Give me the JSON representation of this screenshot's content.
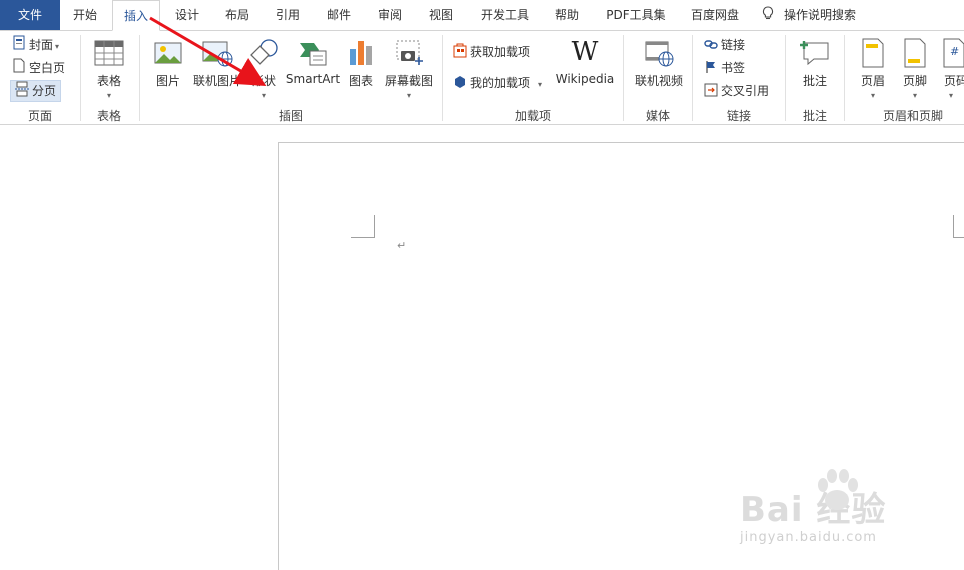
{
  "tabs": [
    "文件",
    "开始",
    "插入",
    "设计",
    "布局",
    "引用",
    "邮件",
    "审阅",
    "视图",
    "开发工具",
    "帮助",
    "PDF工具集",
    "百度网盘"
  ],
  "tell_me": "操作说明搜索",
  "ribbon": {
    "pages": {
      "cover": "封面",
      "blank": "空白页",
      "break": "分页",
      "label": "页面"
    },
    "tables": {
      "table": "表格",
      "label": "表格"
    },
    "illustrations": {
      "picture": "图片",
      "online_picture": "联机图片",
      "shapes": "形状",
      "smartart": "SmartArt",
      "chart": "图表",
      "screenshot": "屏幕截图",
      "label": "插图"
    },
    "addins": {
      "get": "获取加载项",
      "my": "我的加载项",
      "wikipedia": "Wikipedia",
      "label": "加载项"
    },
    "media": {
      "online_video": "联机视频",
      "label": "媒体"
    },
    "links": {
      "link": "链接",
      "bookmark": "书签",
      "cross_ref": "交叉引用",
      "label": "链接"
    },
    "comments": {
      "comment": "批注",
      "label": "批注"
    },
    "header_footer": {
      "header": "页眉",
      "footer": "页脚",
      "page_number": "页码",
      "label": "页眉和页脚"
    }
  },
  "document": {
    "paragraph_mark": "↵"
  },
  "watermark": {
    "brand": "Bai  经验",
    "url": "jingyan.baidu.com"
  },
  "colors": {
    "accent": "#2b579a",
    "arrow": "#e8141b"
  }
}
